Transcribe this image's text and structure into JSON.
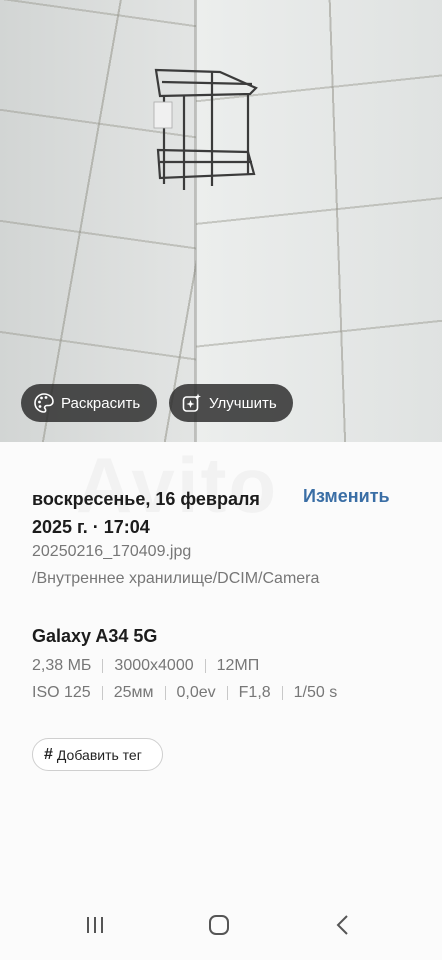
{
  "photo": {
    "colorize_label": "Раскрасить",
    "enhance_label": "Улучшить"
  },
  "watermark": "Avito",
  "details": {
    "date_line1": "воскресенье, 16 февраля",
    "date_line2": "2025 г. · 17:04",
    "edit_label": "Изменить",
    "filename": "20250216_170409.jpg",
    "path": "/Внутреннее хранилище/DCIM/Camera",
    "device": "Galaxy A34 5G",
    "size": "2,38 МБ",
    "resolution": "3000x4000",
    "megapixels": "12МП",
    "iso": "ISO 125",
    "focal_length": "25мм",
    "exposure": "0,0ev",
    "aperture": "F1,8",
    "shutter": "1/50 s",
    "add_tag_label": "Добавить тег"
  },
  "colors": {
    "accent": "#3a6ea5",
    "pill_bg": "#282828"
  }
}
